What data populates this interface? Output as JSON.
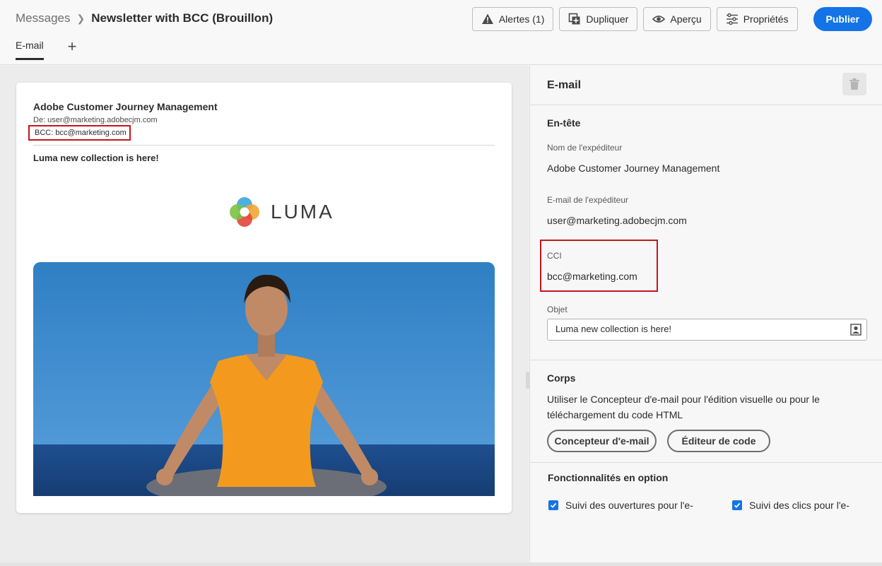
{
  "breadcrumb": {
    "root": "Messages",
    "title": "Newsletter with BCC (Brouillon)"
  },
  "toolbar": {
    "alerts_label": "Alertes (1)",
    "duplicate_label": "Dupliquer",
    "preview_label": "Aperçu",
    "properties_label": "Propriétés",
    "publish_label": "Publier"
  },
  "tabs": [
    {
      "label": "E-mail"
    }
  ],
  "add_tab_glyph": "+",
  "email_preview": {
    "sender": "Adobe Customer Journey Management",
    "from_line": "De: user@marketing.adobecjm.com",
    "bcc_line": "BCC: bcc@marketing.com",
    "subject": "Luma new collection is here!",
    "logo_text": "LUMA"
  },
  "properties": {
    "title": "E-mail",
    "header_section": "En-tête",
    "sender_name_label": "Nom de l'expéditeur",
    "sender_name_value": "Adobe Customer Journey Management",
    "sender_email_label": "E-mail de l'expéditeur",
    "sender_email_value": "user@marketing.adobecjm.com",
    "cci_label": "CCI",
    "cci_value": "bcc@marketing.com",
    "subject_label": "Objet",
    "subject_value": "Luma new collection is here!",
    "body_section": "Corps",
    "body_description": "Utiliser le Concepteur d'e-mail pour l'édition visuelle ou pour le téléchargement du code HTML",
    "designer_button": "Concepteur d'e-mail",
    "code_editor_button": "Éditeur de code",
    "optional_section": "Fonctionnalités en option",
    "opens_tracking": "Suivi des ouvertures pour l'e-",
    "clicks_tracking": "Suivi des clics pour l'e-",
    "opens_checked": true,
    "clicks_checked": true
  },
  "colors": {
    "accent": "#1473e6",
    "highlight": "#c4161c"
  },
  "icons": [
    "alert-icon",
    "duplicate-icon",
    "eye-icon",
    "sliders-icon",
    "trash-icon",
    "personalize-icon",
    "checkmark-icon",
    "luma-logo-icon"
  ]
}
